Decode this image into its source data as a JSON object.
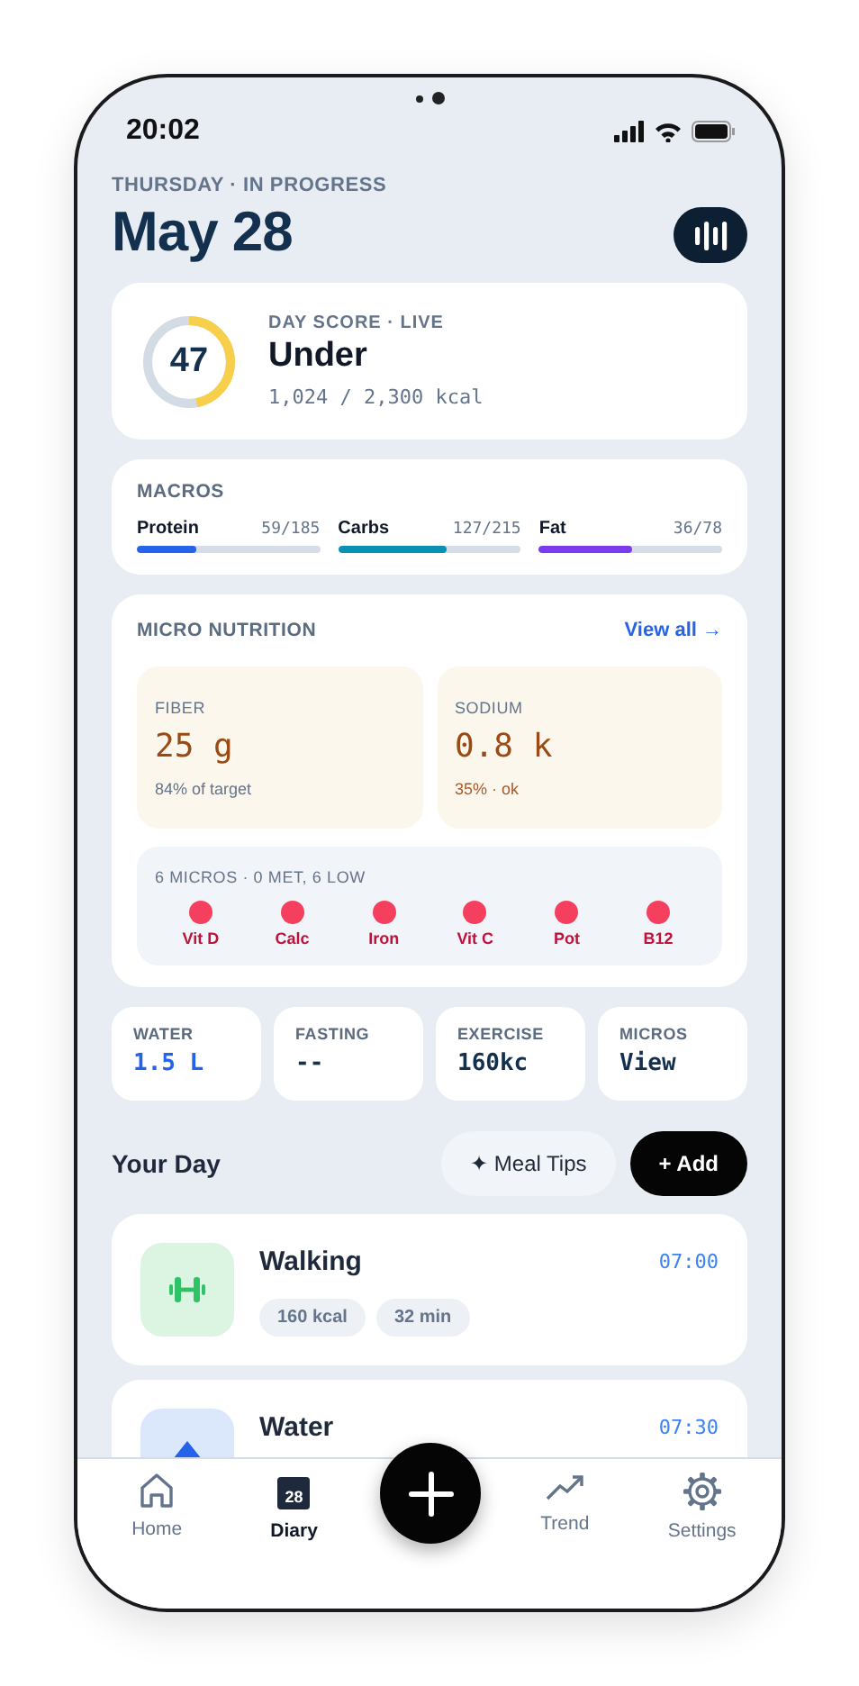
{
  "status_bar": {
    "time": "20:02"
  },
  "header": {
    "day_label": "THURSDAY · IN PROGRESS",
    "title": "May 28"
  },
  "score": {
    "value": "47",
    "level": 0.47,
    "label": "DAY SCORE · LIVE",
    "status": "Under",
    "calories": "1,024 / 2,300 kcal"
  },
  "macros": {
    "title": "MACROS",
    "items": [
      {
        "name": "Protein",
        "reading": "59/185",
        "level": 0.32,
        "color": "#2563eb"
      },
      {
        "name": "Carbs",
        "reading": "127/215",
        "level": 0.59,
        "color": "#0891b2"
      },
      {
        "name": "Fat",
        "reading": "36/78",
        "level": 0.51,
        "color": "#7c3aed"
      }
    ]
  },
  "micro": {
    "title": "MICRO NUTRITION",
    "link": "View all →",
    "highlights": [
      {
        "label": "FIBER",
        "value": "25 g",
        "note": "84% of target",
        "kind": "neutral"
      },
      {
        "label": "SODIUM",
        "value": "0.8 k",
        "note": "35% · ok",
        "kind": "warning"
      }
    ],
    "summary": "6 MICROS · 0 MET, 6 LOW",
    "items": [
      {
        "name": "Vit D",
        "met": false
      },
      {
        "name": "Calc",
        "met": false
      },
      {
        "name": "Iron",
        "met": false
      },
      {
        "name": "Vit C",
        "met": false
      },
      {
        "name": "Pot",
        "met": false
      },
      {
        "name": "B12",
        "met": false
      }
    ]
  },
  "stats": [
    {
      "label": "WATER",
      "value": "1.5 L",
      "accent": true
    },
    {
      "label": "FASTING",
      "value": "--",
      "accent": false
    },
    {
      "label": "EXERCISE",
      "value": "160kc",
      "accent": false
    },
    {
      "label": "MICROS",
      "value": "View",
      "accent": false
    }
  ],
  "your_day": {
    "title": "Your Day",
    "buttons": [
      {
        "label": "✦ Meal Tips",
        "kind": "secondary"
      },
      {
        "label": "+ Add",
        "kind": "primary"
      }
    ]
  },
  "entries": [
    {
      "kind": "exercise",
      "title": "Walking",
      "time": "07:00",
      "tags": [
        "160 kcal",
        "32 min"
      ]
    },
    {
      "kind": "water",
      "title": "Water",
      "time": "07:30"
    }
  ],
  "nav": [
    {
      "label": "Home",
      "kind": "home",
      "selected": false
    },
    {
      "label": "Diary",
      "kind": "calendar",
      "icon_text": "28",
      "selected": true
    },
    {
      "kind": "fab"
    },
    {
      "label": "Trend",
      "kind": "trend",
      "selected": false
    },
    {
      "label": "Settings",
      "kind": "settings",
      "selected": false
    }
  ]
}
